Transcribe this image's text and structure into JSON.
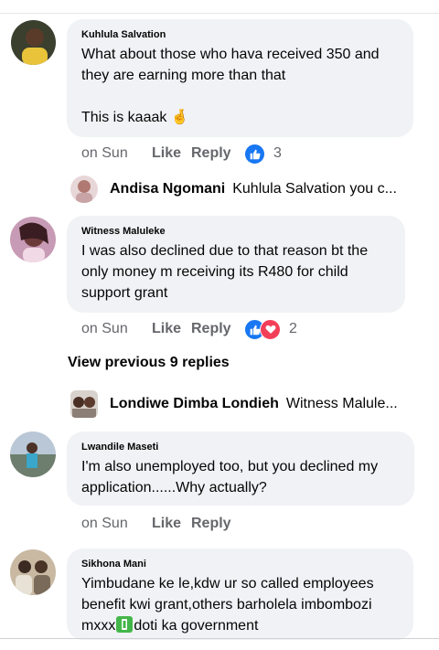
{
  "comments": [
    {
      "author": "Kuhlula Salvation",
      "text": "What about those who hava received 350 and they are earning more than that\n\nThis is kaaak",
      "emoji": "🤞",
      "time": "on Sun",
      "like_label": "Like",
      "reply_label": "Reply",
      "reaction_count": "3",
      "reactions": [
        "like-icon"
      ]
    },
    {
      "author": "Witness Maluleke",
      "text": "I was also declined due to that reason bt the only money m receiving its R480 for child support grant",
      "time": "on Sun",
      "like_label": "Like",
      "reply_label": "Reply",
      "reaction_count": "2",
      "reactions": [
        "like-icon",
        "love-icon"
      ]
    },
    {
      "author": "Lwandile Maseti",
      "text": "I'm also unemployed too, but you declined my application......Why actually?",
      "time": "on Sun",
      "like_label": "Like",
      "reply_label": "Reply"
    },
    {
      "author": "Sikhona Mani",
      "text_before": "Yimbudane ke le,kdw ur so called employees benefit kwi grant,others barholela imbombozi mxxx",
      "text_after": "doti ka government"
    }
  ],
  "replies": [
    {
      "name": "Andisa Ngomani",
      "snippet": "Kuhlula Salvation you c..."
    },
    {
      "name": "Londiwe Dimba Londieh",
      "snippet": "Witness Malule..."
    }
  ],
  "view_previous": "View previous 9 replies",
  "colors": {
    "bubble": "#f0f2f5",
    "secondary_text": "#65676b",
    "like_blue": "#1877f2",
    "love_red": "#f33e58"
  }
}
